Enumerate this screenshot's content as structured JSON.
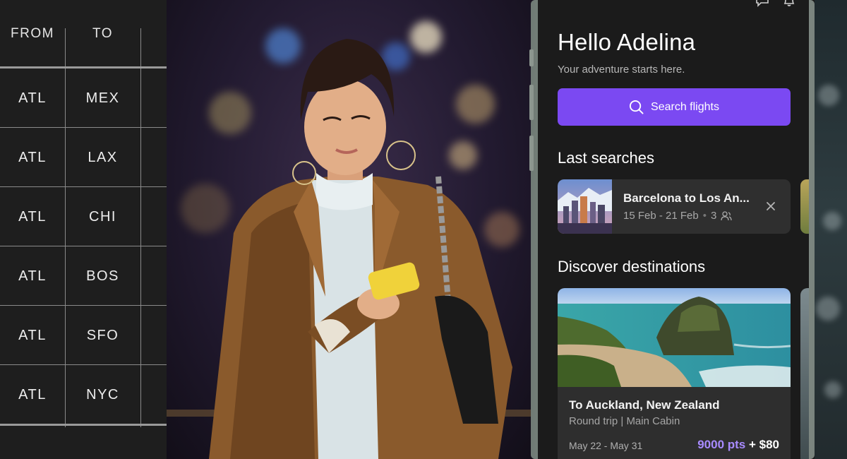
{
  "routes": {
    "header": {
      "from": "FROM",
      "to": "TO"
    },
    "rows": [
      {
        "from": "ATL",
        "to": "MEX"
      },
      {
        "from": "ATL",
        "to": "LAX"
      },
      {
        "from": "ATL",
        "to": "CHI"
      },
      {
        "from": "ATL",
        "to": "BOS"
      },
      {
        "from": "ATL",
        "to": "SFO"
      },
      {
        "from": "ATL",
        "to": "NYC"
      }
    ]
  },
  "app": {
    "greeting": "Hello Adelina",
    "tagline": "Your adventure starts here.",
    "search_label": "Search flights",
    "last_searches_title": "Last searches",
    "last_search": {
      "title": "Barcelona to Los An...",
      "dates": "15 Feb - 21 Feb",
      "separator": "•",
      "travelers": "3"
    },
    "discover_title": "Discover destinations",
    "destination": {
      "title": "To Auckland, New Zealand",
      "trip_type": "Round trip | Main Cabin",
      "dates": "May 22 - May 31",
      "points": "9000 pts",
      "cash": "+ $80"
    },
    "colors": {
      "accent": "#7b49f2",
      "points": "#a88bff",
      "screen_bg": "#1b1b1b",
      "card_bg": "#2f2f2f"
    },
    "icons": [
      "chat-icon",
      "bell-icon",
      "search-icon",
      "people-icon",
      "close-icon"
    ]
  }
}
